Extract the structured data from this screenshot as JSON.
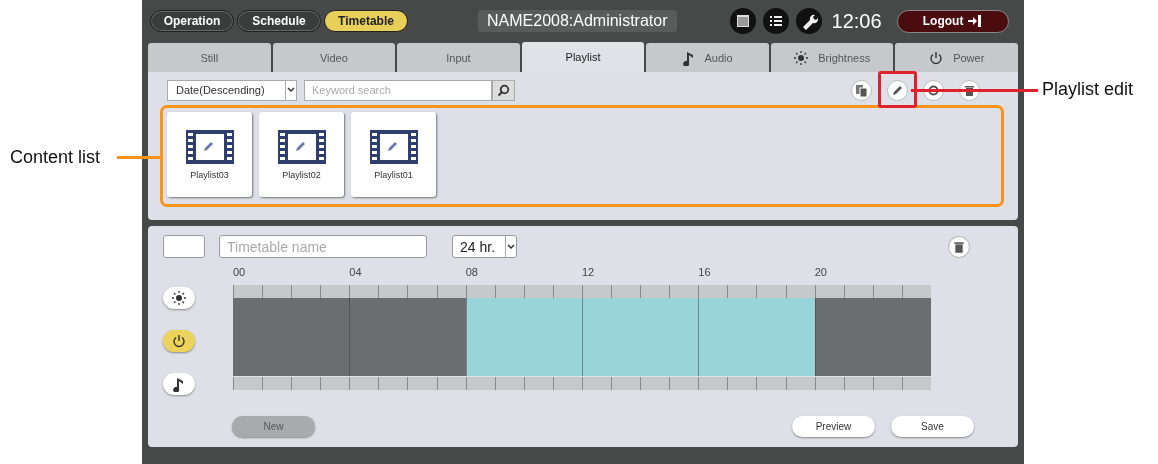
{
  "mode_buttons": [
    {
      "label": "Operation",
      "selected": false
    },
    {
      "label": "Schedule",
      "selected": false
    },
    {
      "label": "Timetable",
      "selected": true
    }
  ],
  "user": "NAME2008:Administrator",
  "header_icons": [
    {
      "kind": "calendar"
    },
    {
      "kind": "list"
    },
    {
      "kind": "wrench"
    }
  ],
  "time": "12:06",
  "logout": "Logout",
  "tabs": [
    {
      "label": "Still",
      "kind": "plain",
      "selected": false
    },
    {
      "label": "Video",
      "kind": "plain",
      "selected": false
    },
    {
      "label": "Input",
      "kind": "plain",
      "selected": false
    },
    {
      "label": "Playlist",
      "kind": "plain",
      "selected": true
    },
    {
      "label": "Audio",
      "kind": "audio",
      "selected": false
    },
    {
      "label": "Brightness",
      "kind": "brightness",
      "selected": false
    },
    {
      "label": "Power",
      "kind": "power",
      "selected": false
    }
  ],
  "content_toolbar": {
    "sort": "Date(Descending)",
    "search_placeholder": "Keyword search",
    "icons": [
      {
        "kind": "copy",
        "highlighted": false
      },
      {
        "kind": "edit",
        "highlighted": true
      },
      {
        "kind": "circle",
        "highlighted": false
      },
      {
        "kind": "trash",
        "highlighted": false
      }
    ]
  },
  "content_list": {
    "highlighted": true,
    "items": [
      {
        "name": "Playlist03"
      },
      {
        "name": "Playlist02"
      },
      {
        "name": "Playlist01"
      }
    ]
  },
  "annotations": [
    {
      "kind": "content_list",
      "text": "Content list"
    },
    {
      "kind": "playlist_edit",
      "text": "Playlist edit"
    }
  ],
  "timetable": {
    "name_placeholder": "Timetable name",
    "range": "24 hr.",
    "hour_labels": [
      "00",
      "04",
      "08",
      "12",
      "16",
      "20"
    ],
    "hours": [
      {
        "on": false
      },
      {
        "on": false
      },
      {
        "on": false
      },
      {
        "on": false
      },
      {
        "on": false
      },
      {
        "on": false
      },
      {
        "on": false
      },
      {
        "on": false
      },
      {
        "on": true
      },
      {
        "on": true
      },
      {
        "on": true
      },
      {
        "on": true
      },
      {
        "on": true
      },
      {
        "on": true
      },
      {
        "on": true
      },
      {
        "on": true
      },
      {
        "on": true
      },
      {
        "on": true
      },
      {
        "on": true
      },
      {
        "on": true
      },
      {
        "on": false
      },
      {
        "on": false
      },
      {
        "on": false
      },
      {
        "on": false
      }
    ],
    "channels": [
      {
        "kind": "brightness",
        "selected": false
      },
      {
        "kind": "power",
        "selected": true
      },
      {
        "kind": "audio",
        "selected": false
      }
    ],
    "buttons": [
      {
        "label": "New",
        "disabled": true
      },
      {
        "label": "Preview",
        "disabled": false
      },
      {
        "label": "Save",
        "disabled": false
      }
    ]
  }
}
